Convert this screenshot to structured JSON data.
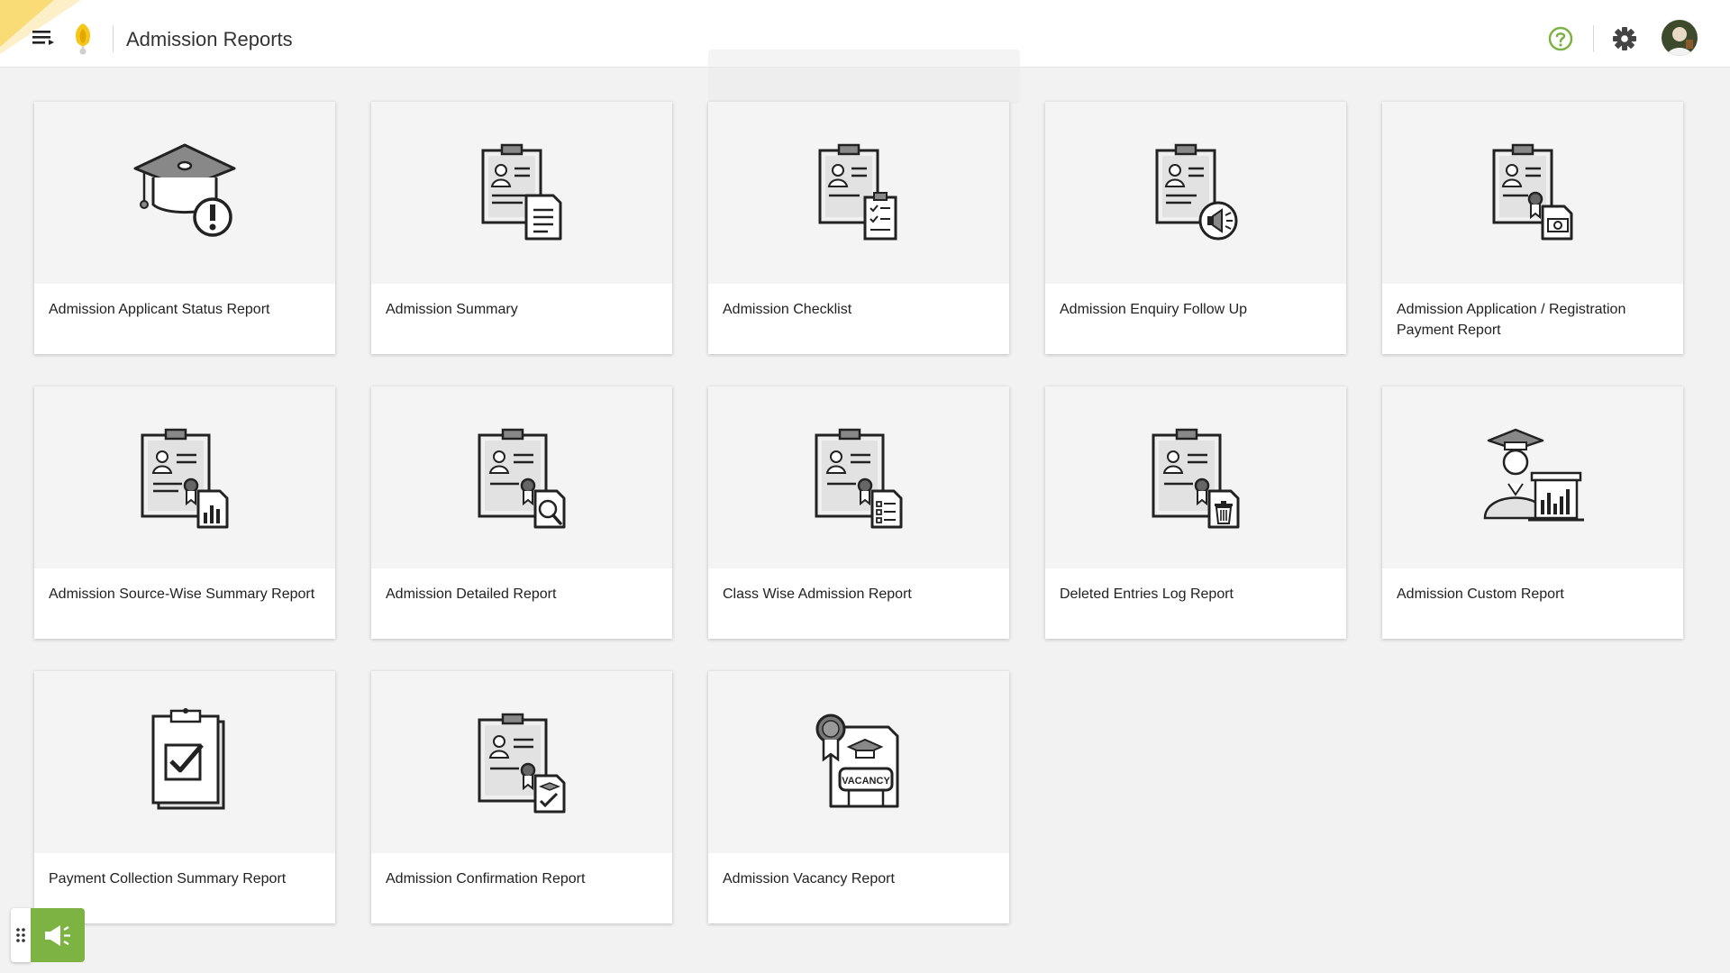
{
  "header": {
    "title": "Admission Reports",
    "menu_icon": "menu-icon",
    "logo_icon": "school-logo-icon",
    "help_icon": "help-icon",
    "settings_icon": "gear-icon",
    "avatar_icon": "user-avatar",
    "accent_color": "#f5c518",
    "help_color": "#7cb342"
  },
  "reports": [
    {
      "label": "Admission Applicant Status Report",
      "icon": "graduation-cap-alert-icon"
    },
    {
      "label": "Admission Summary",
      "icon": "clipboard-document-icon"
    },
    {
      "label": "Admission Checklist",
      "icon": "clipboard-checklist-icon"
    },
    {
      "label": "Admission Enquiry Follow Up",
      "icon": "clipboard-megaphone-icon"
    },
    {
      "label": "Admission Application / Registration Payment Report",
      "icon": "clipboard-payment-icon"
    },
    {
      "label": "Admission Source-Wise Summary Report",
      "icon": "clipboard-bar-chart-icon"
    },
    {
      "label": "Admission Detailed Report",
      "icon": "clipboard-magnifier-icon"
    },
    {
      "label": "Class Wise Admission Report",
      "icon": "clipboard-list-icon"
    },
    {
      "label": "Deleted Entries Log Report",
      "icon": "clipboard-trash-icon"
    },
    {
      "label": "Admission Custom Report",
      "icon": "graduate-chart-icon"
    },
    {
      "label": "Payment Collection Summary Report",
      "icon": "clipboard-check-icon"
    },
    {
      "label": "Admission Confirmation Report",
      "icon": "clipboard-confirm-icon"
    },
    {
      "label": "Admission Vacancy Report",
      "icon": "vacancy-certificate-icon"
    }
  ],
  "fab": {
    "icon": "megaphone-icon",
    "handle_icon": "drag-handle-icon",
    "color": "#7cb342"
  }
}
